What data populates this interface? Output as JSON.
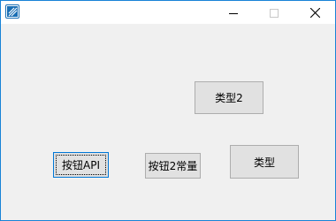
{
  "window": {
    "controls": {
      "minimize_icon": "minimize-icon",
      "maximize_icon": "maximize-icon",
      "close_icon": "close-icon"
    },
    "accent_color": "#1883d7"
  },
  "buttons": {
    "type2_label": "类型2",
    "api_label": "按钮API",
    "const_label": "按钮2常量",
    "type_label": "类型"
  }
}
